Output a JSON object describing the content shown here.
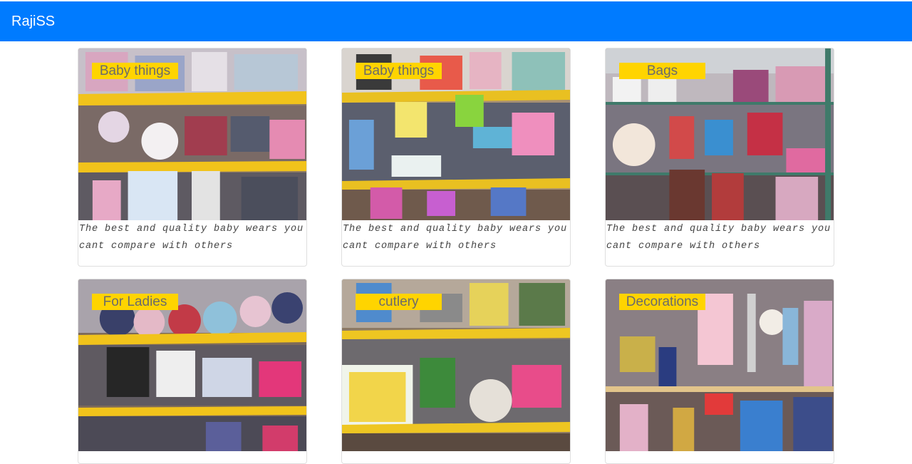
{
  "navbar": {
    "brand": "RajiSS"
  },
  "products": [
    {
      "tag": "Baby things",
      "caption": "The best and quality baby wears you cant compare with others",
      "image": "shelf-baby-clothes"
    },
    {
      "tag": "Baby things",
      "caption": "The best and quality baby wears you cant compare with others",
      "image": "shelf-baby-toys"
    },
    {
      "tag": "Bags",
      "caption": "The best and quality baby wears you cant compare with others",
      "image": "shelf-bags"
    },
    {
      "tag": "For Ladies",
      "caption": "",
      "image": "shelf-ladies-wear"
    },
    {
      "tag": "cutlery",
      "caption": "",
      "image": "shelf-cutlery"
    },
    {
      "tag": "Decorations",
      "caption": "",
      "image": "shelf-decorations"
    }
  ],
  "colors": {
    "navbar": "#007bff",
    "tag_background": "#ffd400",
    "tag_text": "#6b6b6b"
  }
}
